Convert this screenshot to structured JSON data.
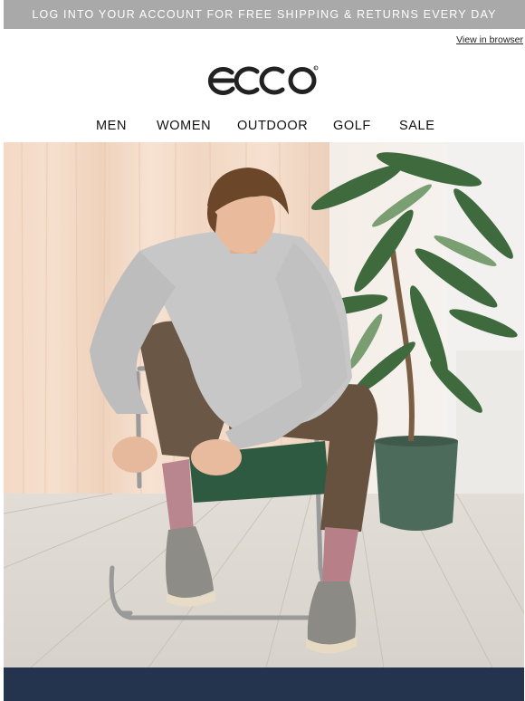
{
  "promo": {
    "text": "LOG INTO YOUR ACCOUNT FOR FREE SHIPPING & RETURNS EVERY DAY"
  },
  "header": {
    "view_in_browser": "View in browser",
    "logo_text": "ecco"
  },
  "nav": {
    "items": [
      {
        "label": "MEN"
      },
      {
        "label": "WOMEN"
      },
      {
        "label": "OUTDOOR"
      },
      {
        "label": "GOLF"
      },
      {
        "label": "SALE"
      }
    ]
  },
  "colors": {
    "promo_bg": "#a9a9a9",
    "footer_bg": "#24344f"
  }
}
